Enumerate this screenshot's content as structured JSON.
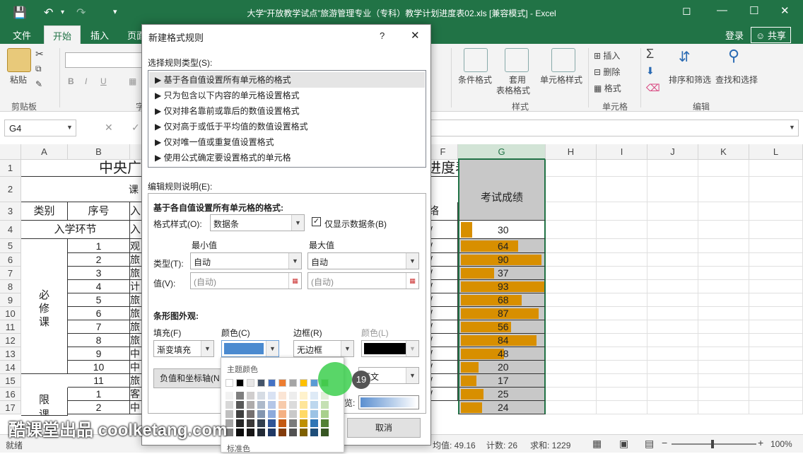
{
  "app": {
    "window_title": "大学“开放教学试点”旅游管理专业（专科）教学计划进度表02.xls  [兼容模式] - Excel",
    "login": "登录",
    "share": "共享"
  },
  "tabs": [
    "文件",
    "开始",
    "插入",
    "页面"
  ],
  "ribbon": {
    "paste": "粘贴",
    "clipboard": "剪贴板",
    "font_group_label": "字",
    "conditional_format": "条件格式",
    "table_format_1": "套用",
    "table_format_2": "表格格式",
    "cell_style": "单元格样式",
    "style_group": "样式",
    "insert": "插入",
    "delete": "删除",
    "format": "格式",
    "cells_group": "单元格",
    "sort_filter": "排序和筛选",
    "find_select": "查找和选择",
    "edit_group": "编辑"
  },
  "formula_bar": {
    "name_box": "G4",
    "cancel": "✕",
    "confirm": "✓",
    "formula": ""
  },
  "columns": [
    "A",
    "B",
    "C",
    "D",
    "E",
    "F",
    "G",
    "H",
    "I",
    "J",
    "K",
    "L"
  ],
  "rows": [
    "1",
    "2",
    "3",
    "4",
    "5",
    "6",
    "7",
    "8",
    "9",
    "10",
    "11",
    "12",
    "13",
    "14",
    "15",
    "16",
    "17"
  ],
  "sheet": {
    "title_left": "中央广",
    "title_right": "进度表",
    "row2_fragment": "课",
    "header_category": "类别",
    "header_seq": "序号",
    "header_fragment_c": "入",
    "header_fragment_f": "络",
    "header_score": "考试成绩",
    "enroll": "入学环节",
    "enroll_c": "入",
    "required_1": "必",
    "required_2": "修",
    "required_3": "课",
    "limit_1": "限",
    "limit_2": "课",
    "seq": [
      "1",
      "2",
      "3",
      "4",
      "5",
      "6",
      "7",
      "8",
      "9",
      "10",
      "11",
      "1",
      "2"
    ],
    "c_fragments": [
      "观",
      "旅",
      "旅",
      "计",
      "旅",
      "旅",
      "旅",
      "旅",
      "中",
      "中",
      "旅",
      "客",
      "中"
    ],
    "f_marks": [
      "/",
      "/",
      "/",
      "/",
      "/",
      "/",
      "/",
      "/",
      "/",
      "/",
      "/",
      "/",
      "/"
    ],
    "scores": [
      30,
      64,
      90,
      37,
      93,
      68,
      87,
      56,
      84,
      48,
      20,
      17,
      25,
      24
    ],
    "score_max": 93
  },
  "dialog": {
    "title": "新建格式规则",
    "help": "?",
    "close": "✕",
    "rule_type_label": "选择规则类型(S):",
    "rule_types": [
      "基于各自值设置所有单元格的格式",
      "只为包含以下内容的单元格设置格式",
      "仅对排名靠前或靠后的数值设置格式",
      "仅对高于或低于平均值的数值设置格式",
      "仅对唯一值或重复值设置格式",
      "使用公式确定要设置格式的单元格"
    ],
    "rule_desc_label": "编辑规则说明(E):",
    "rule_desc_title": "基于各自值设置所有单元格的格式:",
    "format_style_label": "格式样式(O):",
    "format_style_value": "数据条",
    "show_bar_only": "仅显示数据条(B)",
    "min_label": "最小值",
    "max_label": "最大值",
    "type_label": "类型(T):",
    "value_label": "值(V):",
    "min_type": "自动",
    "max_type": "自动",
    "min_value": "(自动)",
    "max_value": "(自动)",
    "bar_appearance": "条形图外观:",
    "fill_label": "填充(F)",
    "color_label": "颜色(C)",
    "border_label": "边框(R)",
    "border_color_label": "颜色(L)",
    "fill_value": "渐变填充",
    "border_value": "无边框",
    "neg_axis_button": "负值和坐标轴(N",
    "direction_fragment": "下文",
    "preview_fragment": "览:",
    "cancel_button": "取消",
    "fill_color": "#4a8ad0"
  },
  "palette": {
    "theme_colors_label": "主题颜色",
    "standard_colors_label": "标准色",
    "click_badge": "19"
  },
  "statusbar": {
    "ready": "就绪",
    "average": "均值: 49.16",
    "count": "计数: 26",
    "sum": "求和: 1229",
    "zoom": "100%"
  },
  "watermark": "酷课堂出品 coolketang.com",
  "colors": {
    "excel_green": "#217346",
    "data_bar": "#d88f00",
    "score_column_bg": "#c8c8c8",
    "highlight": "#3ccf4e"
  }
}
